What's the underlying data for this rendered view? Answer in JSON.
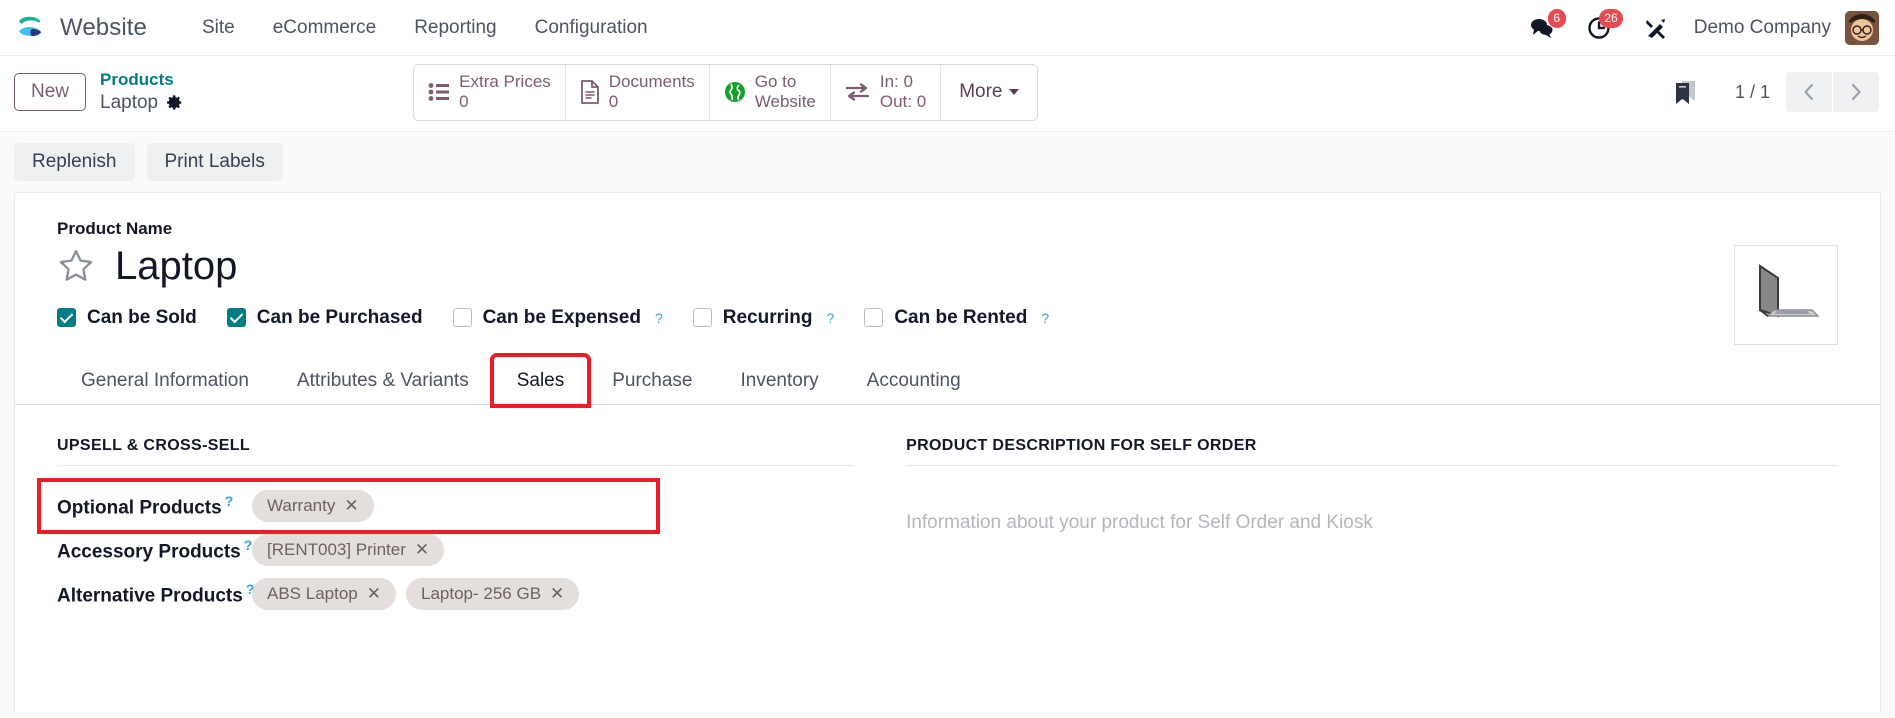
{
  "navbar": {
    "logo_icon": "odoo-logo-icon",
    "brand": "Website",
    "menus": [
      {
        "label": "Site",
        "name": "nav-link-site"
      },
      {
        "label": "eCommerce",
        "name": "nav-link-ecommerce"
      },
      {
        "label": "Reporting",
        "name": "nav-link-reporting"
      },
      {
        "label": "Configuration",
        "name": "nav-link-configuration"
      }
    ],
    "messages_icon": "messages-icon",
    "messages_count": "6",
    "activities_icon": "clock-activities-icon",
    "activities_count": "26",
    "debug_icon": "tools-debug-icon",
    "company": "Demo Company",
    "avatar_icon": "user-avatar"
  },
  "control_panel": {
    "new_label": "New",
    "breadcrumb_parent": "Products",
    "breadcrumb_current": "Laptop",
    "gear_icon": "gear-icon",
    "stat_buttons": [
      {
        "icon": "list-pricelist-icon",
        "line1": "Extra Prices",
        "line2": "0",
        "name": "stat-button-extra-prices"
      },
      {
        "icon": "document-icon",
        "line1": "Documents",
        "line2": "0",
        "name": "stat-button-documents"
      },
      {
        "icon": "globe-icon",
        "line1": "Go to",
        "line2": "Website",
        "name": "stat-button-go-to-website"
      },
      {
        "icon": "in-out-arrows-icon",
        "line1": "In: 0",
        "line2": "Out: 0",
        "name": "stat-button-in-out"
      }
    ],
    "more_label": "More",
    "bookmark_icon": "bookmark-icon",
    "pager": "1 / 1",
    "prev_icon": "chevron-left-icon",
    "next_icon": "chevron-right-icon"
  },
  "action_bar": {
    "buttons": [
      {
        "label": "Replenish",
        "name": "replenish-button"
      },
      {
        "label": "Print Labels",
        "name": "print-labels-button"
      }
    ]
  },
  "form": {
    "product_name_label": "Product Name",
    "product_name": "Laptop",
    "favorite_icon": "star-icon",
    "product_image_icon": "laptop-product-image",
    "checkboxes": [
      {
        "label": "Can be Sold",
        "checked": true,
        "help": false,
        "name": "checkbox-can-be-sold"
      },
      {
        "label": "Can be Purchased",
        "checked": true,
        "help": false,
        "name": "checkbox-can-be-purchased"
      },
      {
        "label": "Can be Expensed",
        "checked": false,
        "help": true,
        "name": "checkbox-can-be-expensed"
      },
      {
        "label": "Recurring",
        "checked": false,
        "help": true,
        "name": "checkbox-recurring"
      },
      {
        "label": "Can be Rented",
        "checked": false,
        "help": true,
        "name": "checkbox-can-be-rented"
      }
    ],
    "tabs": [
      {
        "label": "General Information",
        "active": false,
        "highlighted": false,
        "name": "tab-general-information"
      },
      {
        "label": "Attributes & Variants",
        "active": false,
        "highlighted": false,
        "name": "tab-attributes-variants"
      },
      {
        "label": "Sales",
        "active": true,
        "highlighted": true,
        "name": "tab-sales"
      },
      {
        "label": "Purchase",
        "active": false,
        "highlighted": false,
        "name": "tab-purchase"
      },
      {
        "label": "Inventory",
        "active": false,
        "highlighted": false,
        "name": "tab-inventory"
      },
      {
        "label": "Accounting",
        "active": false,
        "highlighted": false,
        "name": "tab-accounting"
      }
    ],
    "upsell_section_title": "UPSELL & CROSS-SELL",
    "upsell_rows": [
      {
        "label": "Optional Products",
        "help": true,
        "highlighted": true,
        "name": "field-optional-products",
        "tags": [
          {
            "label": "Warranty",
            "name": "tag-warranty"
          }
        ]
      },
      {
        "label": "Accessory Products",
        "help": true,
        "highlighted": false,
        "name": "field-accessory-products",
        "tags": [
          {
            "label": "[RENT003] Printer",
            "name": "tag-rent003-printer"
          }
        ]
      },
      {
        "label": "Alternative Products",
        "help": true,
        "highlighted": false,
        "name": "field-alternative-products",
        "tags": [
          {
            "label": "ABS Laptop",
            "name": "tag-abs-laptop"
          },
          {
            "label": "Laptop- 256 GB",
            "name": "tag-laptop-256-gb"
          }
        ]
      }
    ],
    "self_order_section_title": "PRODUCT DESCRIPTION FOR SELF ORDER",
    "self_order_placeholder": "Information about your product for Self Order and Kiosk"
  },
  "colors": {
    "accent_teal": "#017e84",
    "brand_purple": "#7d5c72",
    "highlight_red": "#ee1c25",
    "badge_red": "#e74a50"
  }
}
